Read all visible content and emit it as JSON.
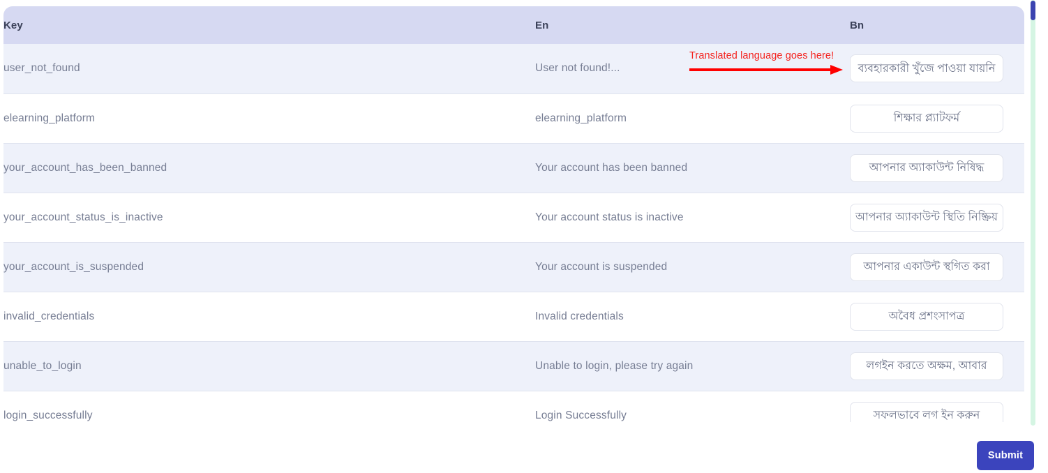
{
  "table": {
    "columns": [
      {
        "id": "key",
        "label": "Key"
      },
      {
        "id": "en",
        "label": "En"
      },
      {
        "id": "bn",
        "label": "Bn"
      }
    ],
    "rows": [
      {
        "key": "user_not_found",
        "en": "User not found!...",
        "bn": "ব্যবহারকারী খুঁজে পাওয়া যায়নি"
      },
      {
        "key": "elearning_platform",
        "en": "elearning_platform",
        "bn": "শিক্ষার প্ল্যাটফর্ম"
      },
      {
        "key": "your_account_has_been_banned",
        "en": "Your account has been banned",
        "bn": "আপনার অ্যাকাউন্ট নিষিদ্ধ"
      },
      {
        "key": "your_account_status_is_inactive",
        "en": "Your account status is inactive",
        "bn": "আপনার অ্যাকাউন্ট স্থিতি নিষ্ক্রিয়"
      },
      {
        "key": "your_account_is_suspended",
        "en": "Your account is suspended",
        "bn": "আপনার একাউন্ট স্থগিত করা"
      },
      {
        "key": "invalid_credentials",
        "en": "Invalid credentials",
        "bn": "অবৈধ প্রশংসাপত্র"
      },
      {
        "key": "unable_to_login",
        "en": "Unable to login, please try again",
        "bn": "লগইন করতে অক্ষম, আবার"
      },
      {
        "key": "login_successfully",
        "en": "Login Successfully",
        "bn": "সফলভাবে লগ ইন করুন"
      }
    ]
  },
  "annotation": {
    "text": "Translated language goes here!",
    "color": "#f4231f"
  },
  "footer": {
    "submit_label": "Submit"
  },
  "colors": {
    "header_bg": "#d6d9f2",
    "row_odd_bg": "#eef1fa",
    "row_even_bg": "#ffffff",
    "submit_bg": "#3b44bd",
    "scrollbar_track": "#d5f5e3",
    "scrollbar_thumb": "#3b44b0"
  }
}
